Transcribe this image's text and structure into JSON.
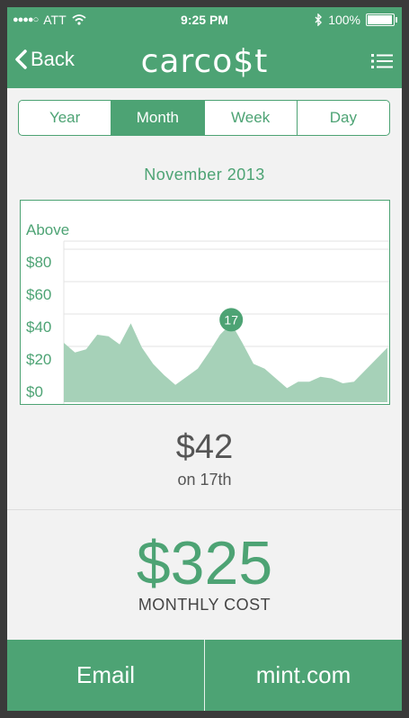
{
  "status_bar": {
    "signal": "●●●●○",
    "carrier": "ATT",
    "time": "9:25 PM",
    "battery_text": "100%",
    "battery_level": 1.0
  },
  "nav": {
    "back_label": "Back",
    "app_title": "carco$t"
  },
  "tabs": [
    {
      "label": "Year",
      "active": false
    },
    {
      "label": "Month",
      "active": true
    },
    {
      "label": "Week",
      "active": false
    },
    {
      "label": "Day",
      "active": false
    }
  ],
  "period_label": "November 2013",
  "chart_data": {
    "type": "area",
    "legend_note": "Above",
    "y_ticks": [
      "$80",
      "$60",
      "$40",
      "$20",
      "$0"
    ],
    "y_tick_values": [
      80,
      60,
      40,
      20,
      0
    ],
    "ylim": [
      0,
      100
    ],
    "x": [
      1,
      2,
      3,
      4,
      5,
      6,
      7,
      8,
      9,
      10,
      11,
      12,
      13,
      14,
      15,
      16,
      17,
      18,
      19,
      20,
      21,
      22,
      23,
      24,
      25,
      26,
      27,
      28,
      29,
      30
    ],
    "values": [
      30,
      24,
      26,
      35,
      34,
      29,
      42,
      27,
      17,
      10,
      4,
      9,
      14,
      24,
      35,
      42,
      30,
      17,
      14,
      8,
      2,
      6,
      6,
      9,
      8,
      5,
      6,
      13,
      20,
      27
    ],
    "highlight": {
      "x": 16,
      "label": "17",
      "value": 42
    },
    "colors": {
      "area": "#a6d1b8",
      "accent": "#4da374",
      "grid": "#e3e3e3"
    }
  },
  "selected_value": {
    "amount": "$42",
    "day": "on 17th"
  },
  "monthly": {
    "amount": "$325",
    "label": "MONTHLY COST"
  },
  "actions": {
    "email": "Email",
    "mint": "mint.com"
  },
  "colors": {
    "brand": "#4da374",
    "background": "#f2f2f2"
  }
}
